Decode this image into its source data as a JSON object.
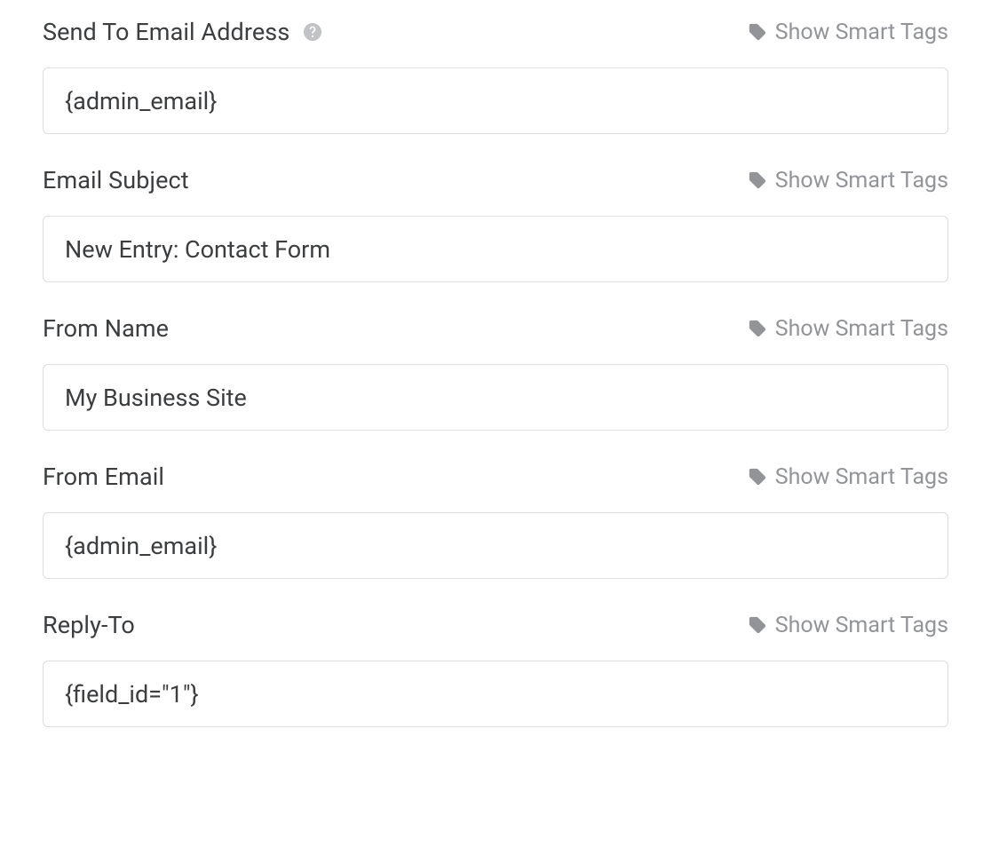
{
  "smart_tags_label": "Show Smart Tags",
  "fields": {
    "send_to": {
      "label": "Send To Email Address",
      "value": "{admin_email}",
      "has_help": true
    },
    "email_subject": {
      "label": "Email Subject",
      "value": "New Entry: Contact Form",
      "has_help": false
    },
    "from_name": {
      "label": "From Name",
      "value": "My Business Site",
      "has_help": false
    },
    "from_email": {
      "label": "From Email",
      "value": "{admin_email}",
      "has_help": false
    },
    "reply_to": {
      "label": "Reply-To",
      "value": "{field_id=\"1\"}",
      "has_help": false
    }
  }
}
